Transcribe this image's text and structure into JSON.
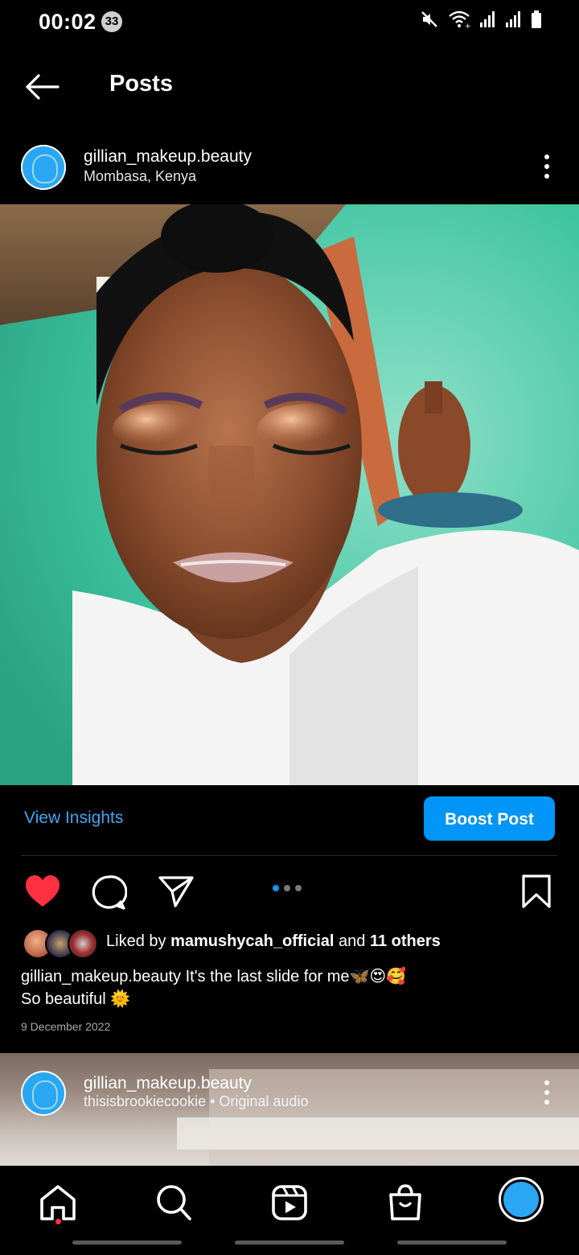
{
  "status_bar": {
    "time": "00:02",
    "notification_count": "33",
    "icons": [
      "mute-icon",
      "wifi-icon",
      "signal-icon",
      "signal-icon",
      "battery-icon"
    ]
  },
  "app_bar": {
    "title": "Posts",
    "back_icon": "arrow-left-icon"
  },
  "post": {
    "username": "gillian_makeup.beauty",
    "location": "Mombasa, Kenya",
    "more_icon": "more-vertical-icon",
    "image_alt": "Selfie showing eye makeup with peach and purple eyeshadow",
    "insights_label": "View Insights",
    "boost_label": "Boost Post",
    "carousel": {
      "count": 3,
      "active_index": 0
    },
    "actions": [
      "heart-icon",
      "comment-icon",
      "share-icon",
      "bookmark-icon"
    ],
    "liked_state": true,
    "likes": {
      "prefix": "Liked by",
      "user": "mamushycah_official",
      "joiner": "and",
      "others": "11 others"
    },
    "caption": {
      "username": "gillian_makeup.beauty",
      "text": "It's the last slide for me🦋😍🥰",
      "line2": "So beautiful 🌞"
    },
    "date": "9 December 2022"
  },
  "next_post": {
    "username": "gillian_makeup.beauty",
    "audio": "thisisbrookiecookie • Original audio"
  },
  "bottom_nav": {
    "items": [
      "home-icon",
      "search-icon",
      "reels-icon",
      "shop-icon",
      "profile-avatar"
    ],
    "home_has_notification": true
  },
  "colors": {
    "accent": "#0095f6",
    "like_red": "#ff3040",
    "link_blue": "#3ea6f4"
  }
}
